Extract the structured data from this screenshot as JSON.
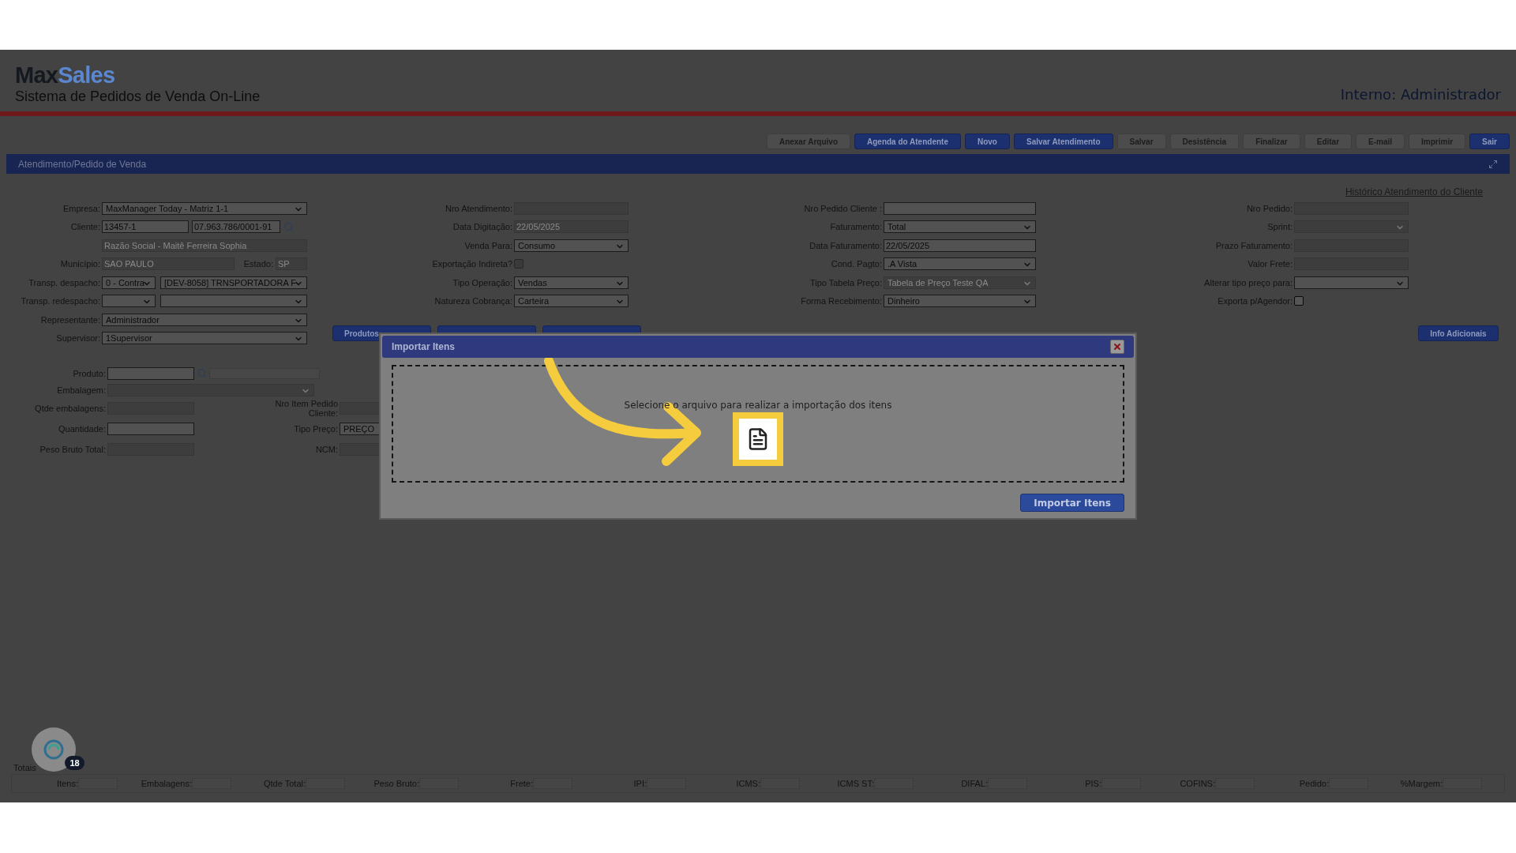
{
  "header": {
    "logo_first": "Max",
    "logo_second": "Sales",
    "subtitle": "Sistema de Pedidos de Venda On-Line",
    "user": "Interno: Administrador"
  },
  "toolbar": [
    {
      "label": "Anexar Arquivo",
      "kind": "plain"
    },
    {
      "label": "Agenda do Atendente",
      "kind": "primary"
    },
    {
      "label": "Novo",
      "kind": "primary"
    },
    {
      "label": "Salvar Atendimento",
      "kind": "primary"
    },
    {
      "label": "Salvar",
      "kind": "plain"
    },
    {
      "label": "Desistência",
      "kind": "plain"
    },
    {
      "label": "Finalizar",
      "kind": "plain"
    },
    {
      "label": "Editar",
      "kind": "plain"
    },
    {
      "label": "E-mail",
      "kind": "plain"
    },
    {
      "label": "Imprimir",
      "kind": "plain"
    },
    {
      "label": "Sair",
      "kind": "primary"
    }
  ],
  "panel_title": "Atendimento/Pedido de Venda",
  "history_link": "Histórico Atendimento do Cliente",
  "form_columns": [
    [
      {
        "label": "Empresa:",
        "kind": "select",
        "value": "MaxManager Today - Matriz 1-1",
        "disabled": false
      },
      {
        "label": "Cliente:",
        "kind": "input-pair",
        "values": [
          "13457-1",
          "07.963.786/0001-91"
        ],
        "disabled": false
      },
      {
        "kind": "note",
        "value": "Razão Social - Maitê Ferreira Sophia",
        "disabled": true
      },
      {
        "label": "Município:",
        "kind": "input-with-state",
        "value": "SAO PAULO",
        "extra_label": "Estado:",
        "extra_value": "SP",
        "disabled": true
      },
      {
        "label": "Transp. despacho:",
        "kind": "select-pair",
        "values": [
          "0 - Contra",
          "[DEV-8058] TRNSPORTADORA F"
        ],
        "disabled": false
      },
      {
        "label": "Transp. redespacho:",
        "kind": "select-pair",
        "disabled": false
      },
      {
        "label": "Representante:",
        "kind": "select",
        "value": "Administrador",
        "disabled": false
      },
      {
        "label": "Supervisor:",
        "kind": "select",
        "value": "1Supervisor",
        "disabled": false
      }
    ],
    [
      {
        "label": "Nro Atendimento:",
        "kind": "input",
        "disabled": true
      },
      {
        "label": "Data Digitação:",
        "kind": "input",
        "value": "22/05/2025",
        "disabled": true
      },
      {
        "label": "Venda Para:",
        "kind": "select",
        "value": "Consumo",
        "disabled": false
      },
      {
        "label": "Exportação Indireta?",
        "kind": "checkbox",
        "checked": false,
        "disabled": true
      },
      {
        "label": "Tipo Operação:",
        "kind": "select",
        "value": "Vendas",
        "disabled": false
      },
      {
        "label": "Natureza Cobrança:",
        "kind": "select",
        "value": "Carteira",
        "disabled": false
      }
    ],
    [
      {
        "label": "Nro Pedido Cliente :",
        "kind": "input",
        "disabled": false
      },
      {
        "label": "Faturamento:",
        "kind": "select",
        "value": "Total",
        "disabled": false
      },
      {
        "label": "Data Faturamento:",
        "kind": "input",
        "value": "22/05/2025",
        "disabled": false
      },
      {
        "label": "Cond. Pagto:",
        "kind": "select",
        "value": ".A Vista",
        "disabled": false
      },
      {
        "label": "Tipo Tabela Preço:",
        "kind": "select",
        "value": "Tabela de Preço Teste QA",
        "disabled": true
      },
      {
        "label": "Forma Recebimento:",
        "kind": "select",
        "value": "Dinheiro",
        "disabled": false
      }
    ],
    [
      {
        "label": "Nro Pedido:",
        "kind": "input",
        "disabled": true
      },
      {
        "label": "Sprint:",
        "kind": "select",
        "disabled": true
      },
      {
        "label": "Prazo Faturamento:",
        "kind": "input",
        "disabled": true
      },
      {
        "label": "Valor Frete:",
        "kind": "input",
        "disabled": true
      },
      {
        "label": "Alterar tipo preço para:",
        "kind": "select",
        "disabled": false
      },
      {
        "label": "Exporta p/Agendor:",
        "kind": "checkbox",
        "checked": false,
        "disabled": false
      }
    ]
  ],
  "action_buttons": [
    {
      "kind": "labelled",
      "label": "Produtos"
    },
    {
      "kind": "covered"
    },
    {
      "kind": "covered"
    }
  ],
  "info_button": "Info Adicionais",
  "product": {
    "fields": [
      {
        "label": "Produto:",
        "kind": "search",
        "disabled": false
      },
      {
        "label": "Embalagem:",
        "kind": "select",
        "disabled": true
      },
      {
        "label": "Qtde embalagens:",
        "kind": "input",
        "disabled": true
      },
      {
        "label": "Quantidade:",
        "kind": "input",
        "disabled": false
      },
      {
        "label": "Peso Bruto Total:",
        "kind": "input",
        "disabled": true
      }
    ],
    "side_fields": [
      {
        "label": "Nro Item Pedido Cliente:",
        "kind": "input",
        "disabled": true
      },
      {
        "label": "Tipo Preço:",
        "kind": "select",
        "value": "PREÇO",
        "disabled": false
      },
      {
        "label": "NCM:",
        "kind": "input",
        "disabled": true
      }
    ]
  },
  "totals": {
    "title": "Totais",
    "items": [
      "Itens:",
      "Embalagens:",
      "Qtde Total:",
      "Peso Bruto:",
      "Frete:",
      "IPI:",
      "ICMS:",
      "ICMS ST:",
      "DIFAL:",
      "PIS:",
      "COFINS:",
      "Pedido:",
      "%Margem:"
    ]
  },
  "chat": {
    "badge": "18"
  },
  "dialog": {
    "title": "Importar Itens",
    "message": "Selecione o arquivo para realizar a importação dos itens",
    "button": "Importar Itens"
  }
}
